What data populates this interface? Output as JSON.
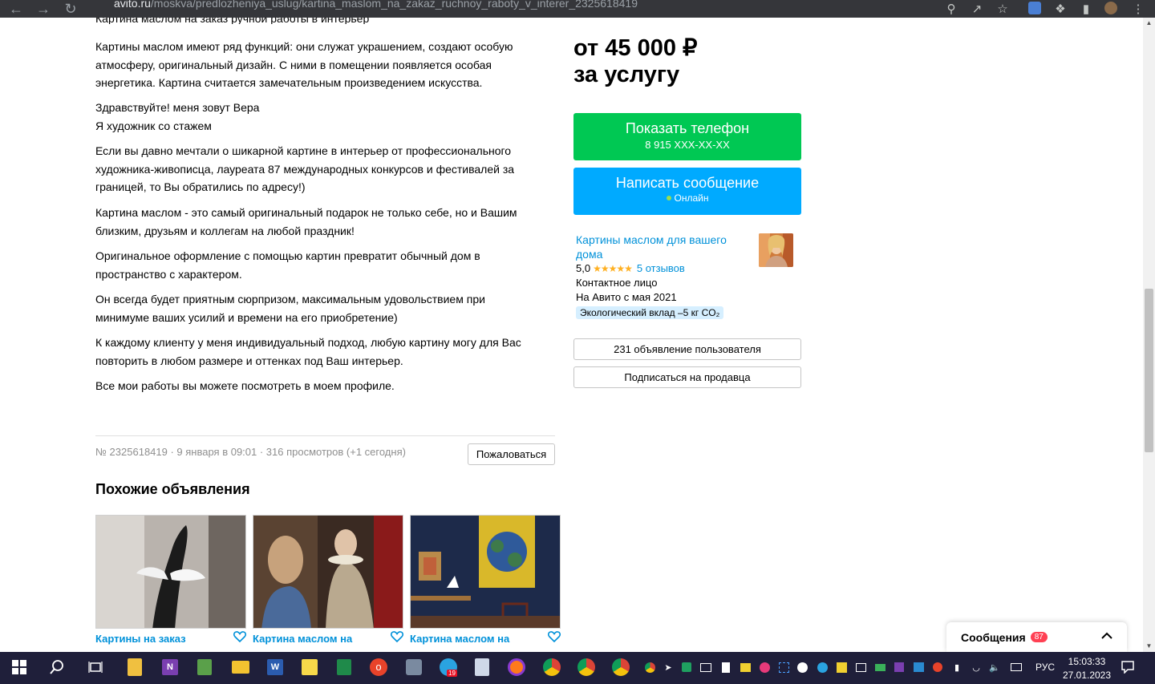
{
  "browser": {
    "url_host": "avito.ru",
    "url_path": "/moskva/predlozheniya_uslug/kartina_maslom_na_zakaz_ruchnoy_raboty_v_interer_2325618419"
  },
  "description": {
    "top_cut_line": "Картина маслом на заказ ручной работы в интерьер",
    "paragraphs": [
      [
        "Картины маслом имеют ряд функций: они служат украшением, создают особую",
        "атмосферу, оригинальный дизайн. С ними в помещении появляется особая",
        "энергетика. Картина считается замечательным произведением искусства."
      ],
      [
        "Здравствуйте! меня зовут Вера",
        "Я художник со стажем"
      ],
      [
        "Если вы давно мечтали о шикарной картине в интерьер от профессионального",
        "художника-живописца, лауреата 87 международных конкурсов и фестивалей за",
        "границей, то Вы обратились по адресу!)"
      ],
      [
        "Картина маслом - это самый оригинальный подарок не только себе, но и Вашим",
        "близким, друзьям и коллегам на любой праздник!"
      ],
      [
        "Оригинальное оформление с помощью картин превратит обычный дом в",
        "пространство с характером."
      ],
      [
        "Он всегда будет приятным сюрпризом, максимальным удовольствием при",
        "минимуме ваших усилий и времени на его приобретение)"
      ],
      [
        "К каждому клиенту у меня индивидуальный подход, любую картину могу для Вас",
        "повторить в любом размере и оттенках под Ваш интерьер."
      ],
      [
        "Все мои работы вы можете посмотреть в моем профиле."
      ]
    ]
  },
  "meta": {
    "text": "№ 2325618419 · 9 января в 09:01 · 316 просмотров (+1 сегодня)",
    "complain_label": "Пожаловаться"
  },
  "similar": {
    "title": "Похожие объявления",
    "items": [
      {
        "title": "Картины на заказ"
      },
      {
        "title": "Картина маслом на"
      },
      {
        "title": "Картина маслом на"
      }
    ]
  },
  "sidebar": {
    "price_line1": "от 45 000 ₽",
    "price_line2": "за услугу",
    "phone_button": {
      "label": "Показать телефон",
      "sub": "8 915 XXX-XX-XX"
    },
    "message_button": {
      "label": "Написать сообщение",
      "sub": "Онлайн"
    },
    "seller": {
      "name": "Картины маслом для вашего дома",
      "rating": "5,0",
      "stars": "★★★★★",
      "reviews": "5 отзывов",
      "contact": "Контактное лицо",
      "since": "На Авито с мая 2021",
      "eco": "Экологический вклад –5 кг CO₂"
    },
    "ads_button": "231 объявление пользователя",
    "subscribe_button": "Подписаться на продавца"
  },
  "messages": {
    "label": "Сообщения",
    "count": "87"
  },
  "taskbar": {
    "lang": "РУС",
    "time": "15:03:33",
    "date": "27.01.2023",
    "telegram_badge": "19"
  },
  "colors": {
    "green": "#00c853",
    "blue": "#00aaff",
    "link": "#0091d9",
    "taskbar": "#1f1f3a"
  }
}
